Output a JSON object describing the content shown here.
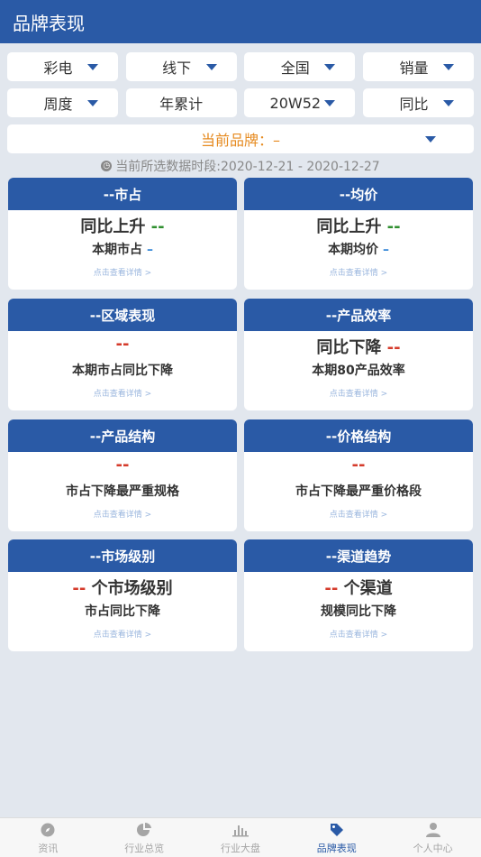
{
  "header": {
    "title": "品牌表现"
  },
  "filters": {
    "row1": [
      {
        "label": "彩电",
        "caret": true
      },
      {
        "label": "线下",
        "caret": true
      },
      {
        "label": "全国",
        "caret": true
      },
      {
        "label": "销量",
        "caret": true
      }
    ],
    "row2": [
      {
        "label": "周度",
        "caret": true
      },
      {
        "label": "年累计",
        "caret": false
      },
      {
        "label": "20W52",
        "caret": true
      },
      {
        "label": "同比",
        "caret": true
      }
    ]
  },
  "brand": {
    "label": "当前品牌：–"
  },
  "period": {
    "text": "当前所选数据时段:2020-12-21 - 2020-12-27"
  },
  "cards": [
    {
      "title": "--市占",
      "big_main": "同比上升 ",
      "big_val": "--",
      "big_color": "green",
      "mid_main": "本期市占 ",
      "mid_val": "–",
      "mid_color": "blue",
      "link": "点击查看详情 >"
    },
    {
      "title": "--均价",
      "big_main": "同比上升 ",
      "big_val": "--",
      "big_color": "green",
      "mid_main": "本期均价 ",
      "mid_val": "–",
      "mid_color": "blue",
      "link": "点击查看详情 >"
    },
    {
      "title": "--区域表现",
      "big_main": "",
      "big_val": "--",
      "big_color": "red",
      "mid_main": "本期市占同比下降",
      "mid_val": "",
      "mid_color": "",
      "link": "点击查看详情 >"
    },
    {
      "title": "--产品效率",
      "big_main": "同比下降 ",
      "big_val": "--",
      "big_color": "red",
      "mid_main": "本期80产品效率",
      "mid_val": "",
      "mid_color": "",
      "link": "点击查看详情 >"
    },
    {
      "title": "--产品结构",
      "big_main": "",
      "big_val": "--",
      "big_color": "red",
      "mid_main": "市占下降最严重规格",
      "mid_val": "",
      "mid_color": "",
      "link": "点击查看详情 >"
    },
    {
      "title": "--价格结构",
      "big_main": "",
      "big_val": "--",
      "big_color": "red",
      "mid_main": "市占下降最严重价格段",
      "mid_val": "",
      "mid_color": "",
      "link": "点击查看详情 >"
    },
    {
      "title": "--市场级别",
      "big_pre": "--",
      "big_main": " 个市场级别",
      "big_color": "red",
      "mid_main": "市占同比下降",
      "mid_val": "",
      "mid_color": "",
      "link": "点击查看详情 >"
    },
    {
      "title": "--渠道趋势",
      "big_pre": "--",
      "big_main": " 个渠道",
      "big_color": "red",
      "mid_main": "规模同比下降",
      "mid_val": "",
      "mid_color": "",
      "link": "点击查看详情 >"
    }
  ],
  "tabs": [
    {
      "label": "资讯",
      "icon": "compass-icon",
      "active": false
    },
    {
      "label": "行业总览",
      "icon": "pie-chart-icon",
      "active": false
    },
    {
      "label": "行业大盘",
      "icon": "bar-chart-icon",
      "active": false
    },
    {
      "label": "品牌表现",
      "icon": "tag-icon",
      "active": true
    },
    {
      "label": "个人中心",
      "icon": "user-icon",
      "active": false
    }
  ]
}
